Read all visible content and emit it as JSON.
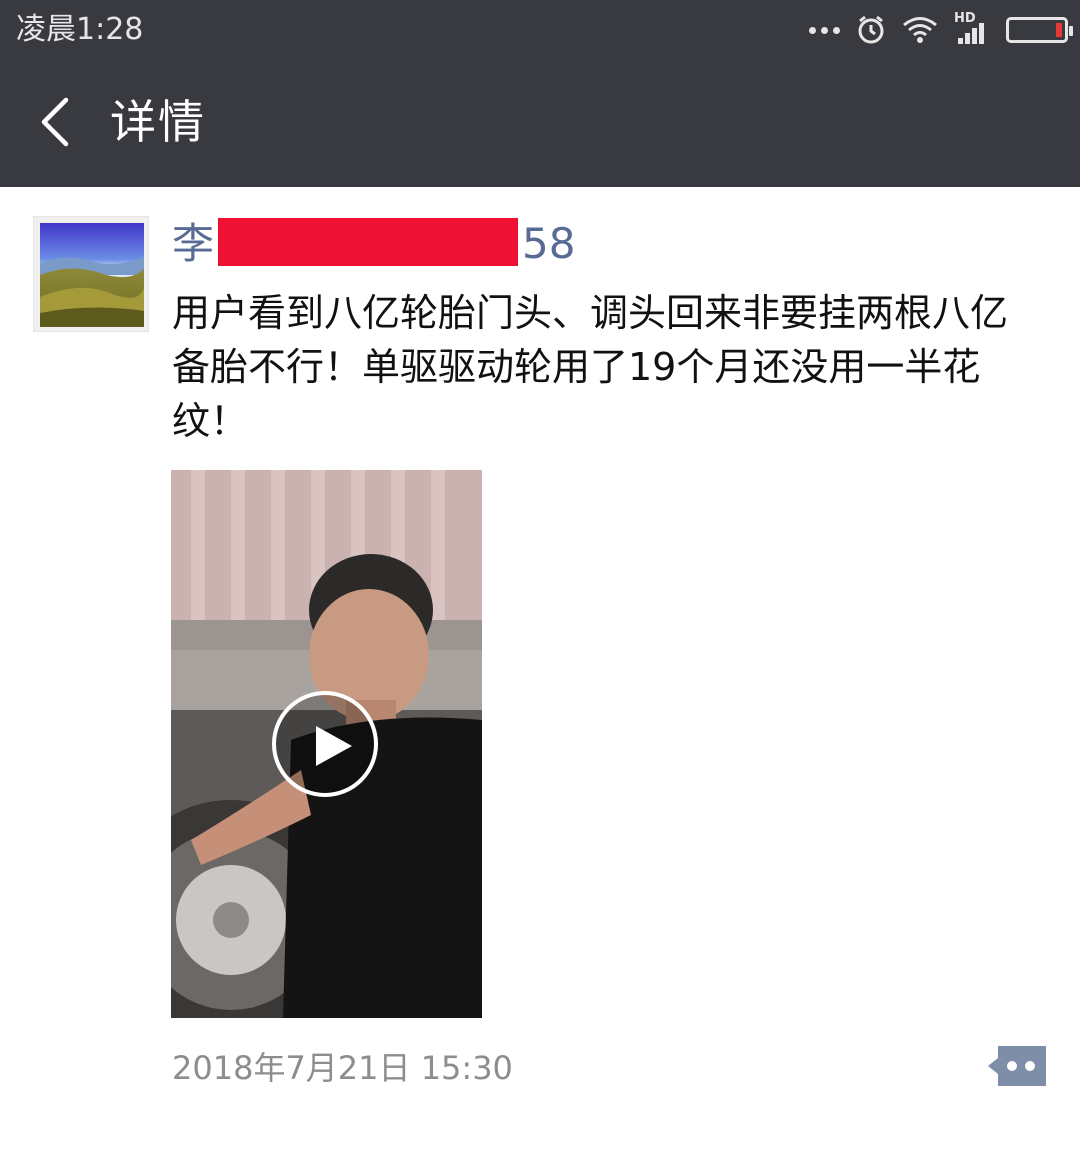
{
  "status_bar": {
    "time": "凌晨1:28",
    "network_label": "HD"
  },
  "header": {
    "title": "详情"
  },
  "post": {
    "author_prefix": "李",
    "author_suffix": "58",
    "text": "用户看到八亿轮胎门头、调头回来非要挂两根八亿备胎不行！单驱驱动轮用了19个月还没用一半花纹！",
    "timestamp": "2018年7月21日 15:30"
  },
  "colors": {
    "header_bg": "#393a3f",
    "author_name": "#576b95",
    "redaction": "#ee1133",
    "comment_button": "#7e8ea8"
  },
  "icons": {
    "back": "chevron-left-icon",
    "comment": "comment-bubble-icon",
    "play": "play-icon"
  }
}
